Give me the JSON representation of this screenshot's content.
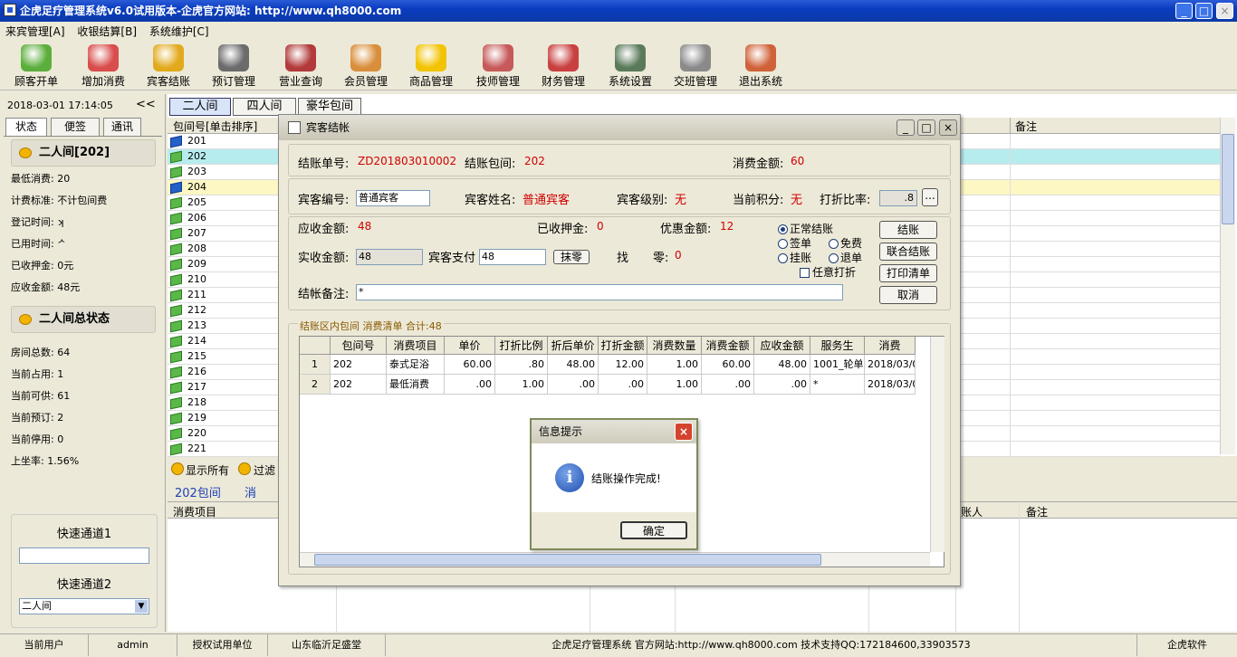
{
  "window": {
    "title": "企虎足疗管理系统v6.0试用版本-企虎官方网站: http://www.qh8000.com",
    "min": "_",
    "max": "□",
    "close": "×"
  },
  "menu": [
    "来宾管理[A]",
    "收银结算[B]",
    "系统维护[C]"
  ],
  "toolbar": [
    {
      "label": "顾客开单",
      "icon": "customer-icon",
      "color": "#5cae3c"
    },
    {
      "label": "增加消费",
      "icon": "add-consume-icon",
      "color": "#d94d4d"
    },
    {
      "label": "宾客结账",
      "icon": "checkout-icon",
      "color": "#e2a91d"
    },
    {
      "label": "预订管理",
      "icon": "alarm-clock-icon",
      "color": "#6b6b6b"
    },
    {
      "label": "营业查询",
      "icon": "query-icon",
      "color": "#b23a3a"
    },
    {
      "label": "会员管理",
      "icon": "members-icon",
      "color": "#d98e3b"
    },
    {
      "label": "商品管理",
      "icon": "star-icon",
      "color": "#f2c300"
    },
    {
      "label": "技师管理",
      "icon": "technician-icon",
      "color": "#c65a5a"
    },
    {
      "label": "财务管理",
      "icon": "finance-icon",
      "color": "#c94040"
    },
    {
      "label": "系统设置",
      "icon": "settings-icon",
      "color": "#5a7a5a"
    },
    {
      "label": "交班管理",
      "icon": "handshake-icon",
      "color": "#8a8a8a"
    },
    {
      "label": "退出系统",
      "icon": "exit-icon",
      "color": "#d0623a"
    }
  ],
  "left": {
    "datetime": "2018-03-01  17:14:05",
    "collapse": "<<",
    "tabs": [
      "状态",
      "便签",
      "通讯"
    ],
    "room_title": "二人间[202]",
    "room_info": [
      "最低消费: 20",
      "计费标准: 不计包间费",
      "登记时间: ʞ",
      "已用时间: ᄼ",
      "已收押金: 0元",
      "应收金额: 48元"
    ],
    "status_title": "二人间总状态",
    "status_info": [
      "房间总数: 64",
      "当前占用: 1",
      "当前可供: 61",
      "当前预订: 2",
      "当前停用: 0",
      "上坐率:   1.56%"
    ],
    "quick1_label": "快速通道1",
    "quick2_label": "快速通道2",
    "quick2_value": "二人间"
  },
  "room_tabs": [
    "二人间",
    "四人间",
    "豪华包间"
  ],
  "room_grid": {
    "col1": "包间号[单击排序]",
    "col_remark": "备注",
    "rooms": [
      {
        "no": "201",
        "flag": "blue",
        "bg": "#ffffff"
      },
      {
        "no": "202",
        "flag": "green",
        "bg": "#b7ecef"
      },
      {
        "no": "203",
        "flag": "green",
        "bg": "#ffffff"
      },
      {
        "no": "204",
        "flag": "blue",
        "bg": "#fdf7c4"
      },
      {
        "no": "205",
        "flag": "green",
        "bg": "#ffffff"
      },
      {
        "no": "206",
        "flag": "green",
        "bg": "#ffffff"
      },
      {
        "no": "207",
        "flag": "green",
        "bg": "#ffffff"
      },
      {
        "no": "208",
        "flag": "green",
        "bg": "#ffffff"
      },
      {
        "no": "209",
        "flag": "green",
        "bg": "#ffffff"
      },
      {
        "no": "210",
        "flag": "green",
        "bg": "#ffffff"
      },
      {
        "no": "211",
        "flag": "green",
        "bg": "#ffffff"
      },
      {
        "no": "212",
        "flag": "green",
        "bg": "#ffffff"
      },
      {
        "no": "213",
        "flag": "green",
        "bg": "#ffffff"
      },
      {
        "no": "214",
        "flag": "green",
        "bg": "#ffffff"
      },
      {
        "no": "215",
        "flag": "green",
        "bg": "#ffffff"
      },
      {
        "no": "216",
        "flag": "green",
        "bg": "#ffffff"
      },
      {
        "no": "217",
        "flag": "green",
        "bg": "#ffffff"
      },
      {
        "no": "218",
        "flag": "green",
        "bg": "#ffffff"
      },
      {
        "no": "219",
        "flag": "green",
        "bg": "#ffffff"
      },
      {
        "no": "220",
        "flag": "green",
        "bg": "#ffffff"
      },
      {
        "no": "221",
        "flag": "green",
        "bg": "#ffffff"
      }
    ]
  },
  "filter": {
    "show_all": "显示所有",
    "filter": "过滤",
    "room_label": "202包间",
    "consume": "消"
  },
  "bottom_grid": {
    "col_item": "消费项目",
    "col_person": "账人",
    "col_remark": "备注"
  },
  "status_bar": [
    "当前用户",
    "admin",
    "授权试用单位",
    "山东临沂足盛堂",
    "企虎足疗管理系统 官方网站:http://www.qh8000.com 技术支持QQ:172184600,33903573",
    "企虎软件"
  ],
  "dialog": {
    "title": "宾客结帐",
    "bill_no_label": "结账单号:",
    "bill_no": "ZD201803010002",
    "room_label": "结账包间:",
    "room": "202",
    "amount_label": "消费金额:",
    "amount": "60",
    "guest_no_label": "宾客编号:",
    "guest_no": "普通宾客",
    "guest_name_label": "宾客姓名:",
    "guest_name": "普通宾客",
    "guest_level_label": "宾客级别:",
    "guest_level": "无",
    "points_label": "当前积分:",
    "points": "无",
    "discount_label": "打折比率:",
    "discount": ".8",
    "ellipsis": "...",
    "due_label": "应收金额:",
    "due": "48",
    "deposit_label": "已收押金:",
    "deposit": "0",
    "promo_label": "优惠金额:",
    "promo": "12",
    "paid_label": "实收金额:",
    "paid": "48",
    "guest_pay_label": "宾客支付",
    "guest_pay": "48",
    "round_btn": "抹零",
    "change_label1": "找",
    "change_label2": "零:",
    "change": "0",
    "modes": {
      "normal": "正常结账",
      "sign": "签单",
      "free": "免费",
      "hang": "挂账",
      "refund": "退单",
      "any_discount": "任意打折"
    },
    "buttons": {
      "checkout": "结账",
      "joint": "联合结账",
      "print": "打印清单",
      "cancel": "取消"
    },
    "note_label": "结帐备注:",
    "note": "*",
    "detail_caption": "结账区内包间   消费清单   合计:48",
    "columns": [
      "包间号",
      "消费项目",
      "单价",
      "打折比例",
      "折后单价",
      "打折金额",
      "消费数量",
      "消费金额",
      "应收金额",
      "服务生",
      "消费"
    ],
    "rows": [
      {
        "idx": "1",
        "cells": [
          "202",
          "泰式足浴",
          "60.00",
          ".80",
          "48.00",
          "12.00",
          "1.00",
          "60.00",
          "48.00",
          "1001_轮单",
          "2018/03/0"
        ]
      },
      {
        "idx": "2",
        "cells": [
          "202",
          "最低消费",
          ".00",
          "1.00",
          ".00",
          ".00",
          "1.00",
          ".00",
          ".00",
          "*",
          "2018/03/0"
        ]
      }
    ]
  },
  "msgbox": {
    "title": "信息提示",
    "text": "结账操作完成!",
    "ok": "确定",
    "close": "×",
    "info_glyph": "i"
  }
}
